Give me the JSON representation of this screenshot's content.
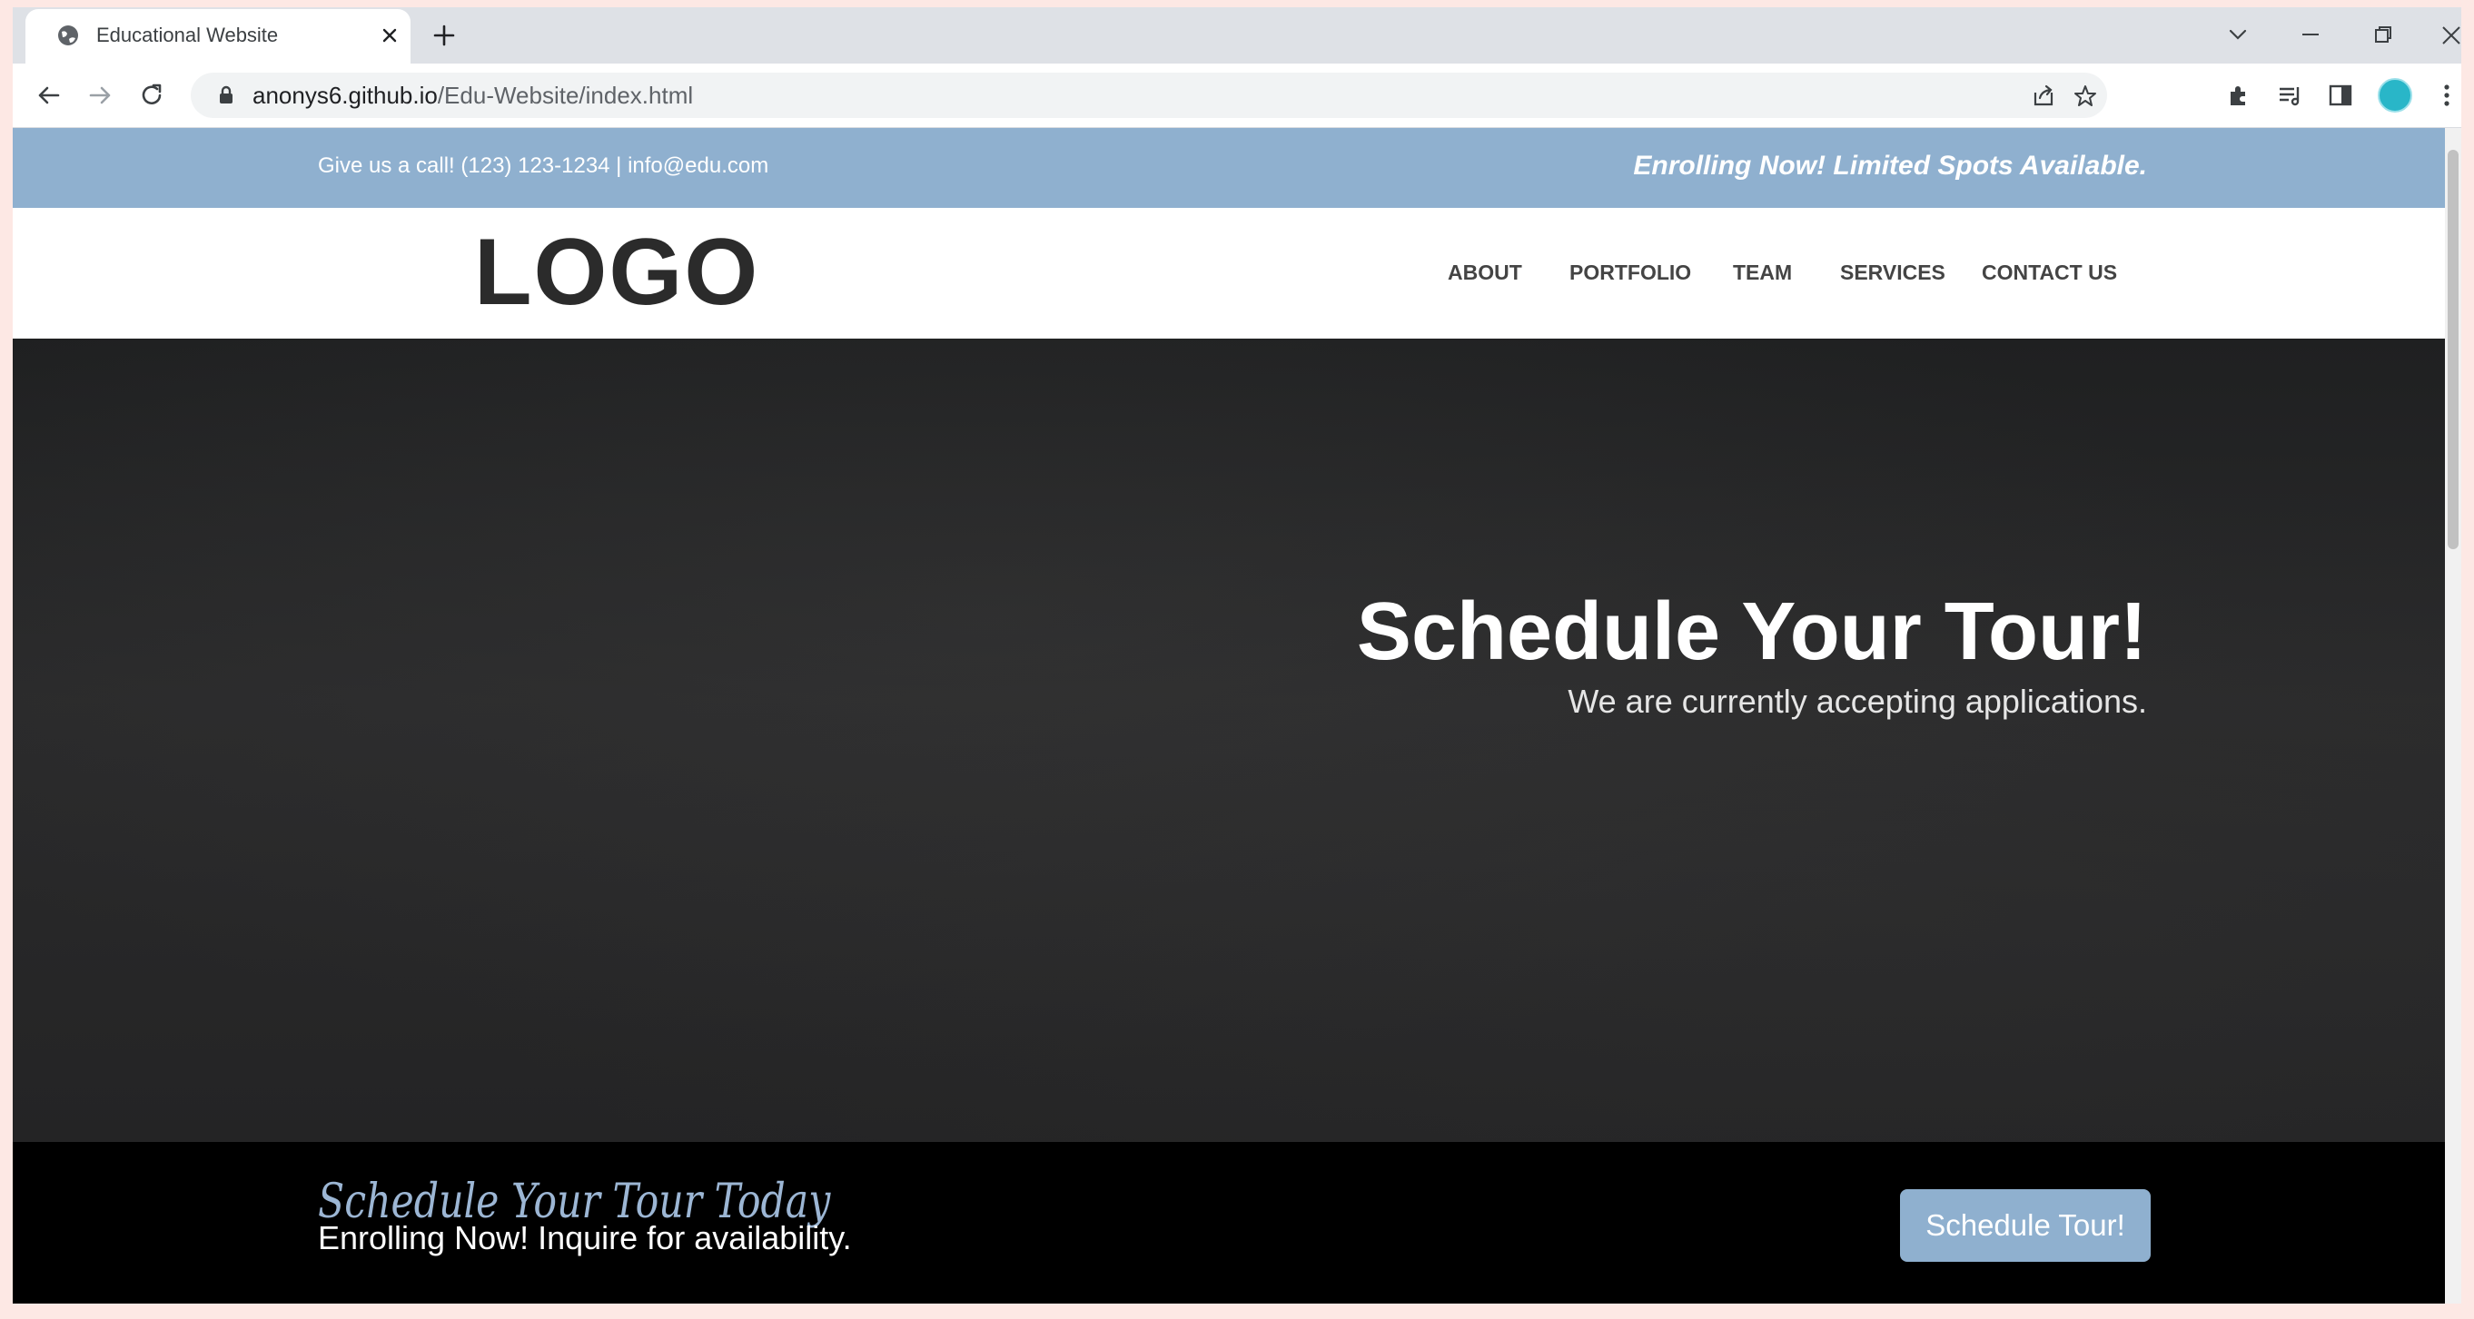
{
  "browser": {
    "tab_title": "Educational Website",
    "url_host": "anonys6.github.io",
    "url_path": "/Edu-Website/index.html"
  },
  "page": {
    "topbar": {
      "contact": "Give us a call! (123) 123-1234 | info@edu.com",
      "enrolling": "Enrolling Now! Limited Spots Available."
    },
    "header": {
      "logo": "LOGO",
      "nav": [
        "ABOUT",
        "PORTFOLIO",
        "TEAM",
        "SERVICES",
        "CONTACT US"
      ]
    },
    "hero": {
      "title": "Schedule Your Tour!",
      "subtitle": "We are currently accepting applications."
    },
    "cta": {
      "script_heading": "Schedule Your Tour Today",
      "text": "Enrolling Now! Inquire for availability.",
      "button": "Schedule Tour!"
    }
  },
  "colors": {
    "accent": "#8fb0cf",
    "hero_bg": "#252526",
    "cta_bg": "#000000",
    "script_text": "#9cb6d4"
  }
}
